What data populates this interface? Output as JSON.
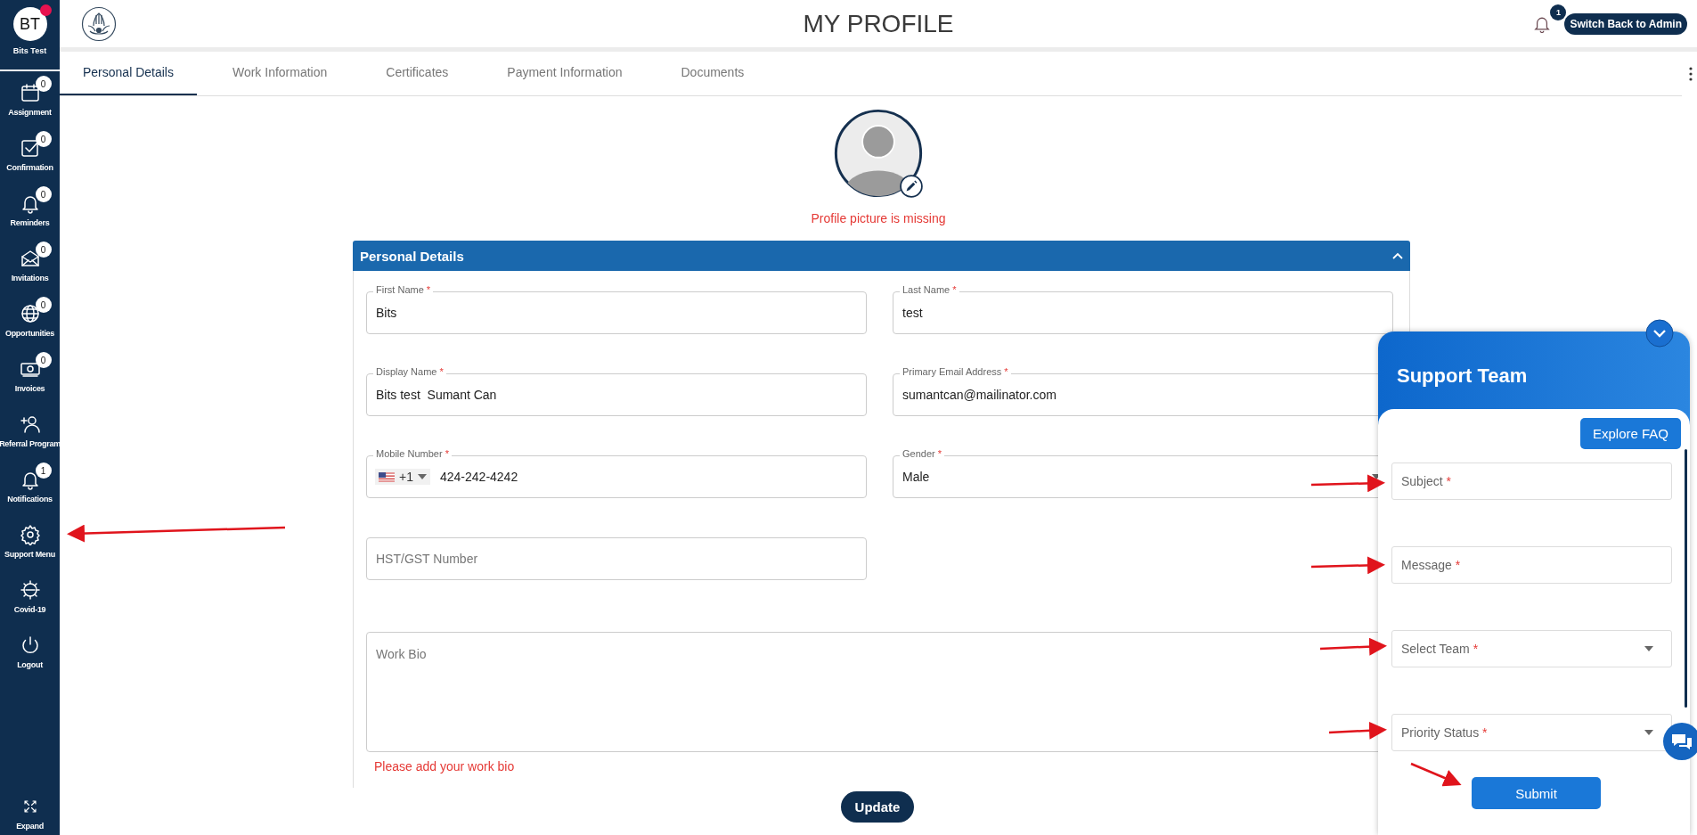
{
  "sidebar": {
    "user": {
      "initials": "BT",
      "name": "Bits Test",
      "online_dot": true
    },
    "items": [
      {
        "label": "Assignment",
        "badge": "0"
      },
      {
        "label": "Confirmation",
        "badge": "0"
      },
      {
        "label": "Reminders",
        "badge": "0"
      },
      {
        "label": "Invitations",
        "badge": "0"
      },
      {
        "label": "Opportunities",
        "badge": "0"
      },
      {
        "label": "Invoices",
        "badge": "0"
      },
      {
        "label": "Referral Program"
      },
      {
        "label": "Notifications",
        "badge": "1"
      },
      {
        "label": "Support Menu"
      },
      {
        "label": "Covid-19"
      },
      {
        "label": "Logout"
      }
    ],
    "expand": "Expand"
  },
  "header": {
    "title": "MY PROFILE",
    "notification_count": "1",
    "switch_button": "Switch Back to Admin"
  },
  "tabs": [
    {
      "label": "Personal Details",
      "selected": true
    },
    {
      "label": "Work Information",
      "selected": false
    },
    {
      "label": "Certificates",
      "selected": false
    },
    {
      "label": "Payment Information",
      "selected": false
    },
    {
      "label": "Documents",
      "selected": false
    }
  ],
  "profile": {
    "picture_error": "Profile picture is missing"
  },
  "section": {
    "title": "Personal Details",
    "expanded": true,
    "fields": [
      {
        "kind": "text",
        "label": "First Name",
        "mark": "*",
        "value": "Bits"
      },
      {
        "kind": "text",
        "label": "Last Name",
        "mark": "*",
        "value": "test"
      },
      {
        "kind": "text",
        "label": "Display Name",
        "mark": "*",
        "value": "Bits test  Sumant Can"
      },
      {
        "kind": "text",
        "label": "Primary Email Address",
        "mark": "*",
        "value": "sumantcan@mailinator.com"
      },
      {
        "kind": "phone",
        "label": "Mobile Number",
        "mark": "*",
        "code": "+1",
        "value": "424-242-4242"
      },
      {
        "kind": "select",
        "label": "Gender",
        "mark": "*",
        "value": "Male"
      },
      {
        "kind": "text",
        "placeholder": "HST/GST Number"
      },
      {
        "kind": "textarea",
        "placeholder": "Work Bio",
        "error": "Please add your work bio"
      }
    ]
  },
  "update_button": "Update",
  "support": {
    "title": "Support Team",
    "faq_button": "Explore FAQ",
    "fields": [
      {
        "kind": "text",
        "placeholder": "Subject",
        "mark": "*"
      },
      {
        "kind": "text",
        "placeholder": "Message",
        "mark": "*"
      },
      {
        "kind": "select",
        "placeholder": "Select Team",
        "mark": "*"
      },
      {
        "kind": "select",
        "placeholder": "Priority Status",
        "mark": "*"
      }
    ],
    "submit": "Submit"
  }
}
